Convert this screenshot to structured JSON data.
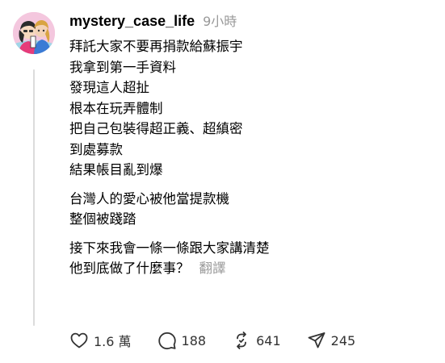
{
  "post": {
    "username": "mystery_case_life",
    "timestamp": "9小時",
    "paragraphs": [
      [
        "拜託大家不要再捐款給蘇振宇",
        "我拿到第一手資料",
        "發現這人超扯",
        "根本在玩弄體制",
        "把自己包裝得超正義、超縝密",
        "到處募款",
        "結果帳目亂到爆"
      ],
      [
        "台灣人的愛心被他當提款機",
        "整個被踐踏"
      ],
      [
        "接下來我會一條一條跟大家講清楚",
        "他到底做了什麼事？"
      ]
    ],
    "translate_label": "翻譯",
    "actions": {
      "like": {
        "icon": "heart-icon",
        "count": "1.6 萬"
      },
      "reply": {
        "icon": "comment-icon",
        "count": "188"
      },
      "repost": {
        "icon": "repost-icon",
        "count": "641"
      },
      "share": {
        "icon": "send-icon",
        "count": "245"
      }
    }
  }
}
